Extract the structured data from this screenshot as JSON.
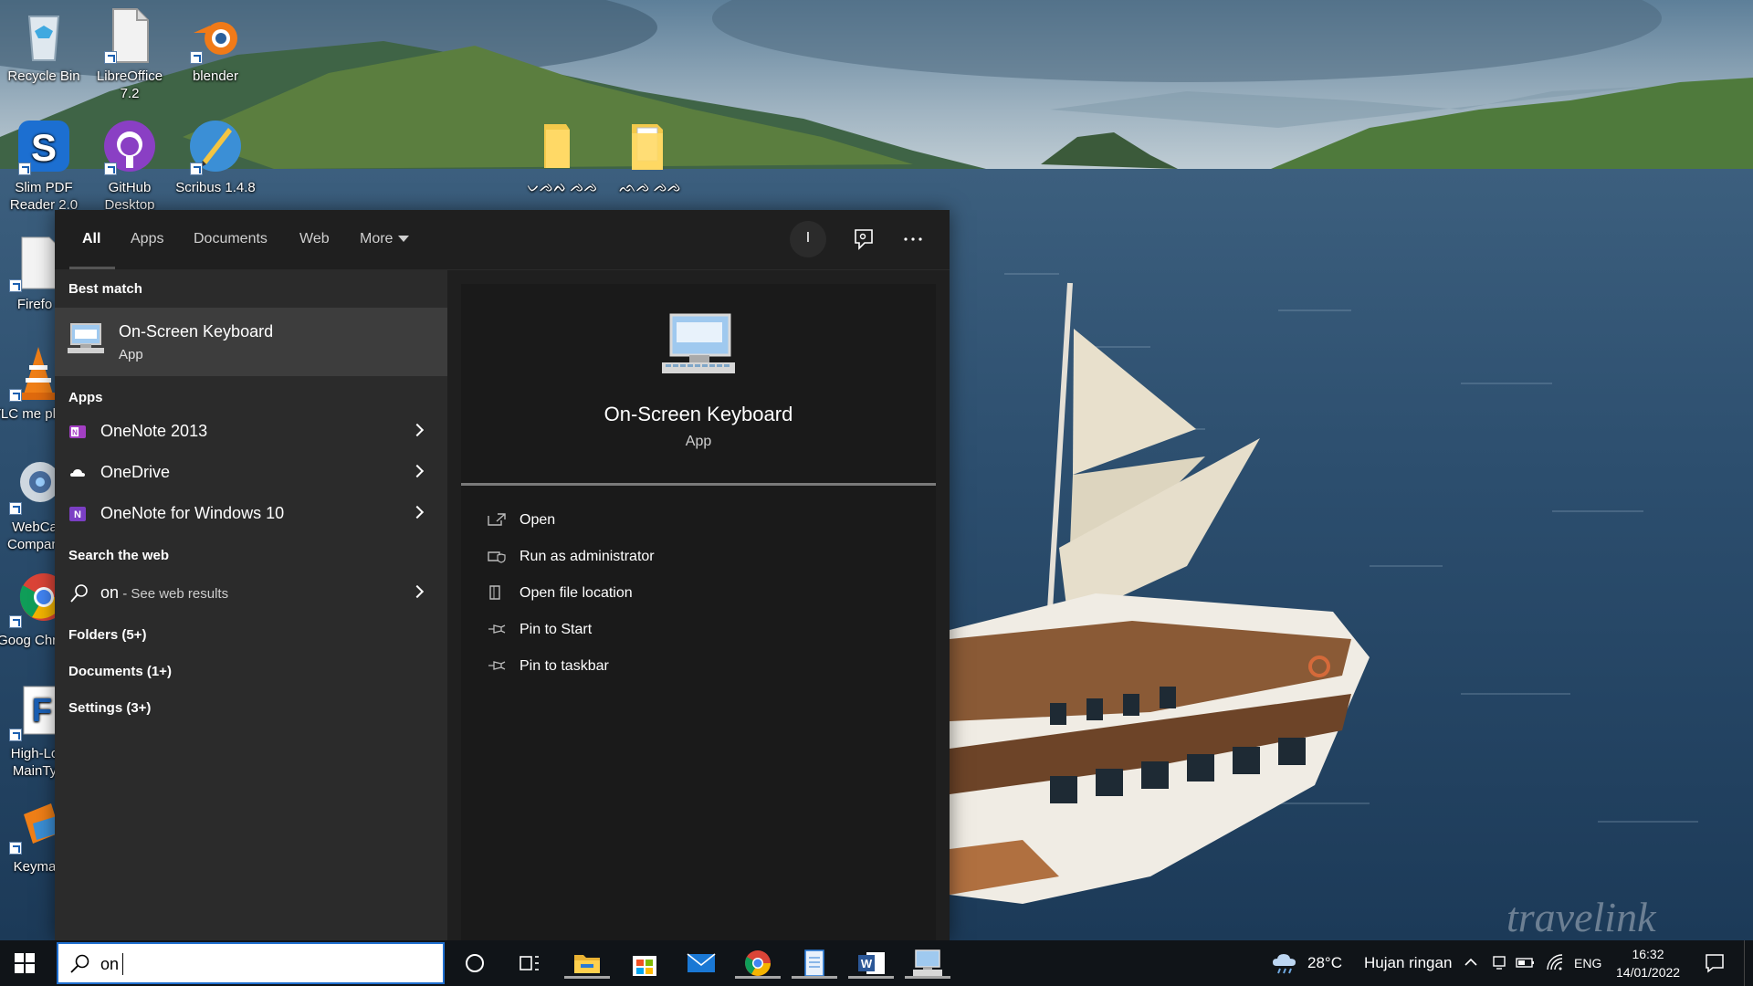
{
  "desktop": {
    "icons": [
      {
        "label": "Recycle Bin",
        "icon": "recycle-bin-icon"
      },
      {
        "label": "LibreOffice 7.2",
        "icon": "libreoffice-icon"
      },
      {
        "label": "blender",
        "icon": "blender-icon"
      },
      {
        "label": "Slim PDF Reader 2.0",
        "icon": "slim-pdf-icon"
      },
      {
        "label": "GitHub Desktop",
        "icon": "github-icon"
      },
      {
        "label": "Scribus 1.4.8",
        "icon": "scribus-icon"
      },
      {
        "label": "ᨆᨌᨄ ᨌᨌ",
        "icon": "folder-icon"
      },
      {
        "label": "ᨒᨌ ᨌᨌ",
        "icon": "folder-icon"
      },
      {
        "label": "Firefo",
        "icon": "firefox-icon"
      },
      {
        "label": "VLC me playe",
        "icon": "vlc-icon"
      },
      {
        "label": "WebCa Compani",
        "icon": "webcam-icon"
      },
      {
        "label": "Goog Chron",
        "icon": "chrome-icon"
      },
      {
        "label": "High-Lo MainTy",
        "icon": "highlow-icon"
      },
      {
        "label": "Keyma",
        "icon": "keyman-icon"
      }
    ],
    "watermark": "travelink"
  },
  "search_panel": {
    "tabs": [
      {
        "label": "All",
        "active": true
      },
      {
        "label": "Apps"
      },
      {
        "label": "Documents"
      },
      {
        "label": "Web"
      },
      {
        "label": "More"
      }
    ],
    "avatar_letter": "I",
    "best_match": {
      "header": "Best match",
      "title": "On-Screen Keyboard",
      "subtitle": "App"
    },
    "apps": {
      "header": "Apps",
      "items": [
        {
          "label": "OneNote 2013",
          "icon": "onenote-icon"
        },
        {
          "label": "OneDrive",
          "icon": "onedrive-icon"
        },
        {
          "label": "OneNote for Windows 10",
          "icon": "onenote-icon"
        }
      ]
    },
    "web": {
      "header": "Search the web",
      "query": "on",
      "suffix": " - See web results"
    },
    "categories": [
      "Folders (5+)",
      "Documents (1+)",
      "Settings (3+)"
    ],
    "detail": {
      "title": "On-Screen Keyboard",
      "subtitle": "App",
      "actions": [
        {
          "label": "Open",
          "icon": "open-icon"
        },
        {
          "label": "Run as administrator",
          "icon": "shield-icon"
        },
        {
          "label": "Open file location",
          "icon": "file-location-icon"
        },
        {
          "label": "Pin to Start",
          "icon": "pin-icon"
        },
        {
          "label": "Pin to taskbar",
          "icon": "pin-icon"
        }
      ]
    }
  },
  "taskbar": {
    "search_query": "on",
    "apps": [
      "cortana-icon",
      "task-view-icon",
      "file-explorer-icon",
      "store-icon",
      "mail-icon",
      "chrome-icon",
      "notepad-icon",
      "word-icon",
      "osk-icon"
    ],
    "weather": {
      "temp": "28°C",
      "condition": "Hujan ringan"
    },
    "language": "ENG",
    "time": "16:32",
    "date": "14/01/2022"
  }
}
